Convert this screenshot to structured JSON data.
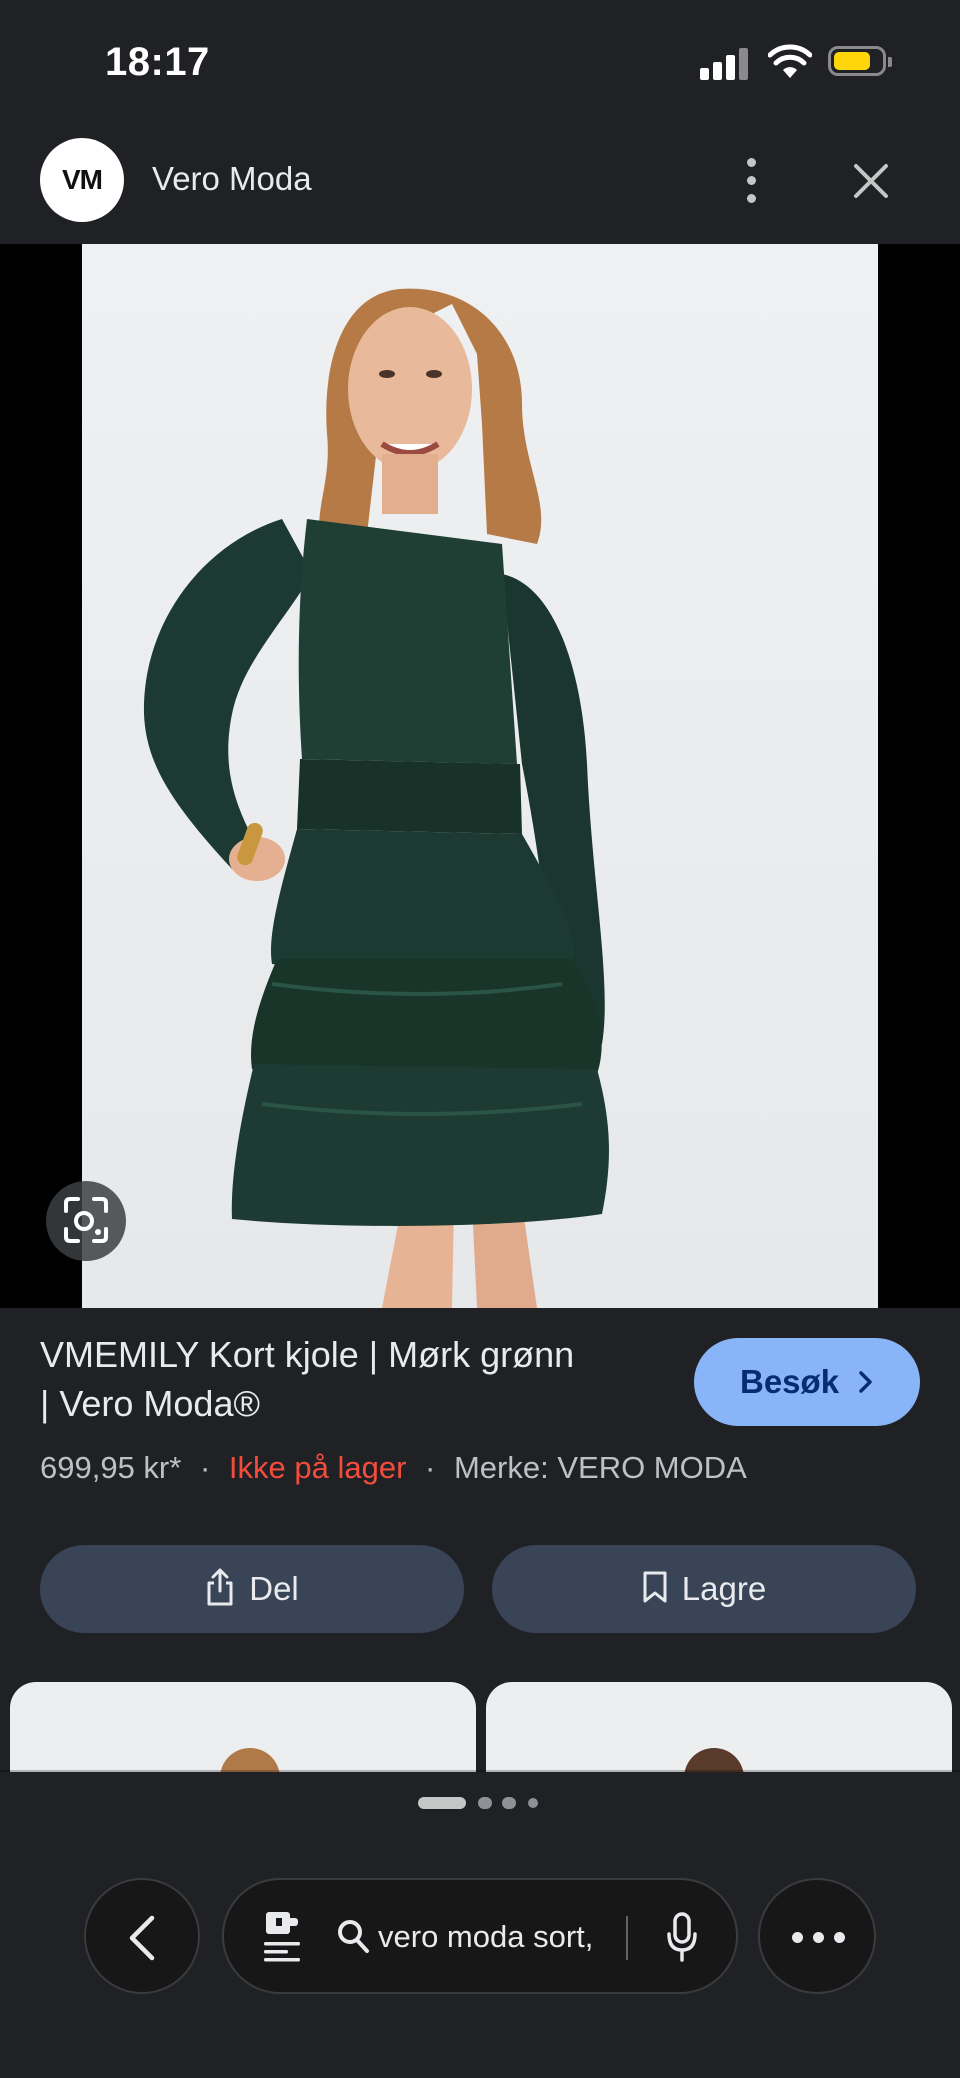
{
  "status_bar": {
    "time": "18:17"
  },
  "header": {
    "logo_text": "VM",
    "site_name": "Vero Moda"
  },
  "product": {
    "title_line1": "VMEMILY Kort kjole | Mørk grønn",
    "title_line2": "| Vero Moda®",
    "price": "699,95 kr*",
    "stock_status": "Ikke på lager",
    "brand": "Merke: VERO MODA",
    "dot": "·"
  },
  "buttons": {
    "visit": "Besøk",
    "share": "Del",
    "save": "Lagre"
  },
  "search": {
    "query": "vero moda sort,"
  },
  "colors": {
    "accent": "#8ab4f8",
    "out_of_stock": "#f24c3d",
    "dress": "#1e3b33"
  },
  "icons": [
    "menu-dots-icon",
    "close-icon",
    "visual-search-icon",
    "share-icon",
    "bookmark-icon",
    "back-arrow-icon",
    "lens-icon",
    "search-icon",
    "mic-icon",
    "more-icon"
  ]
}
